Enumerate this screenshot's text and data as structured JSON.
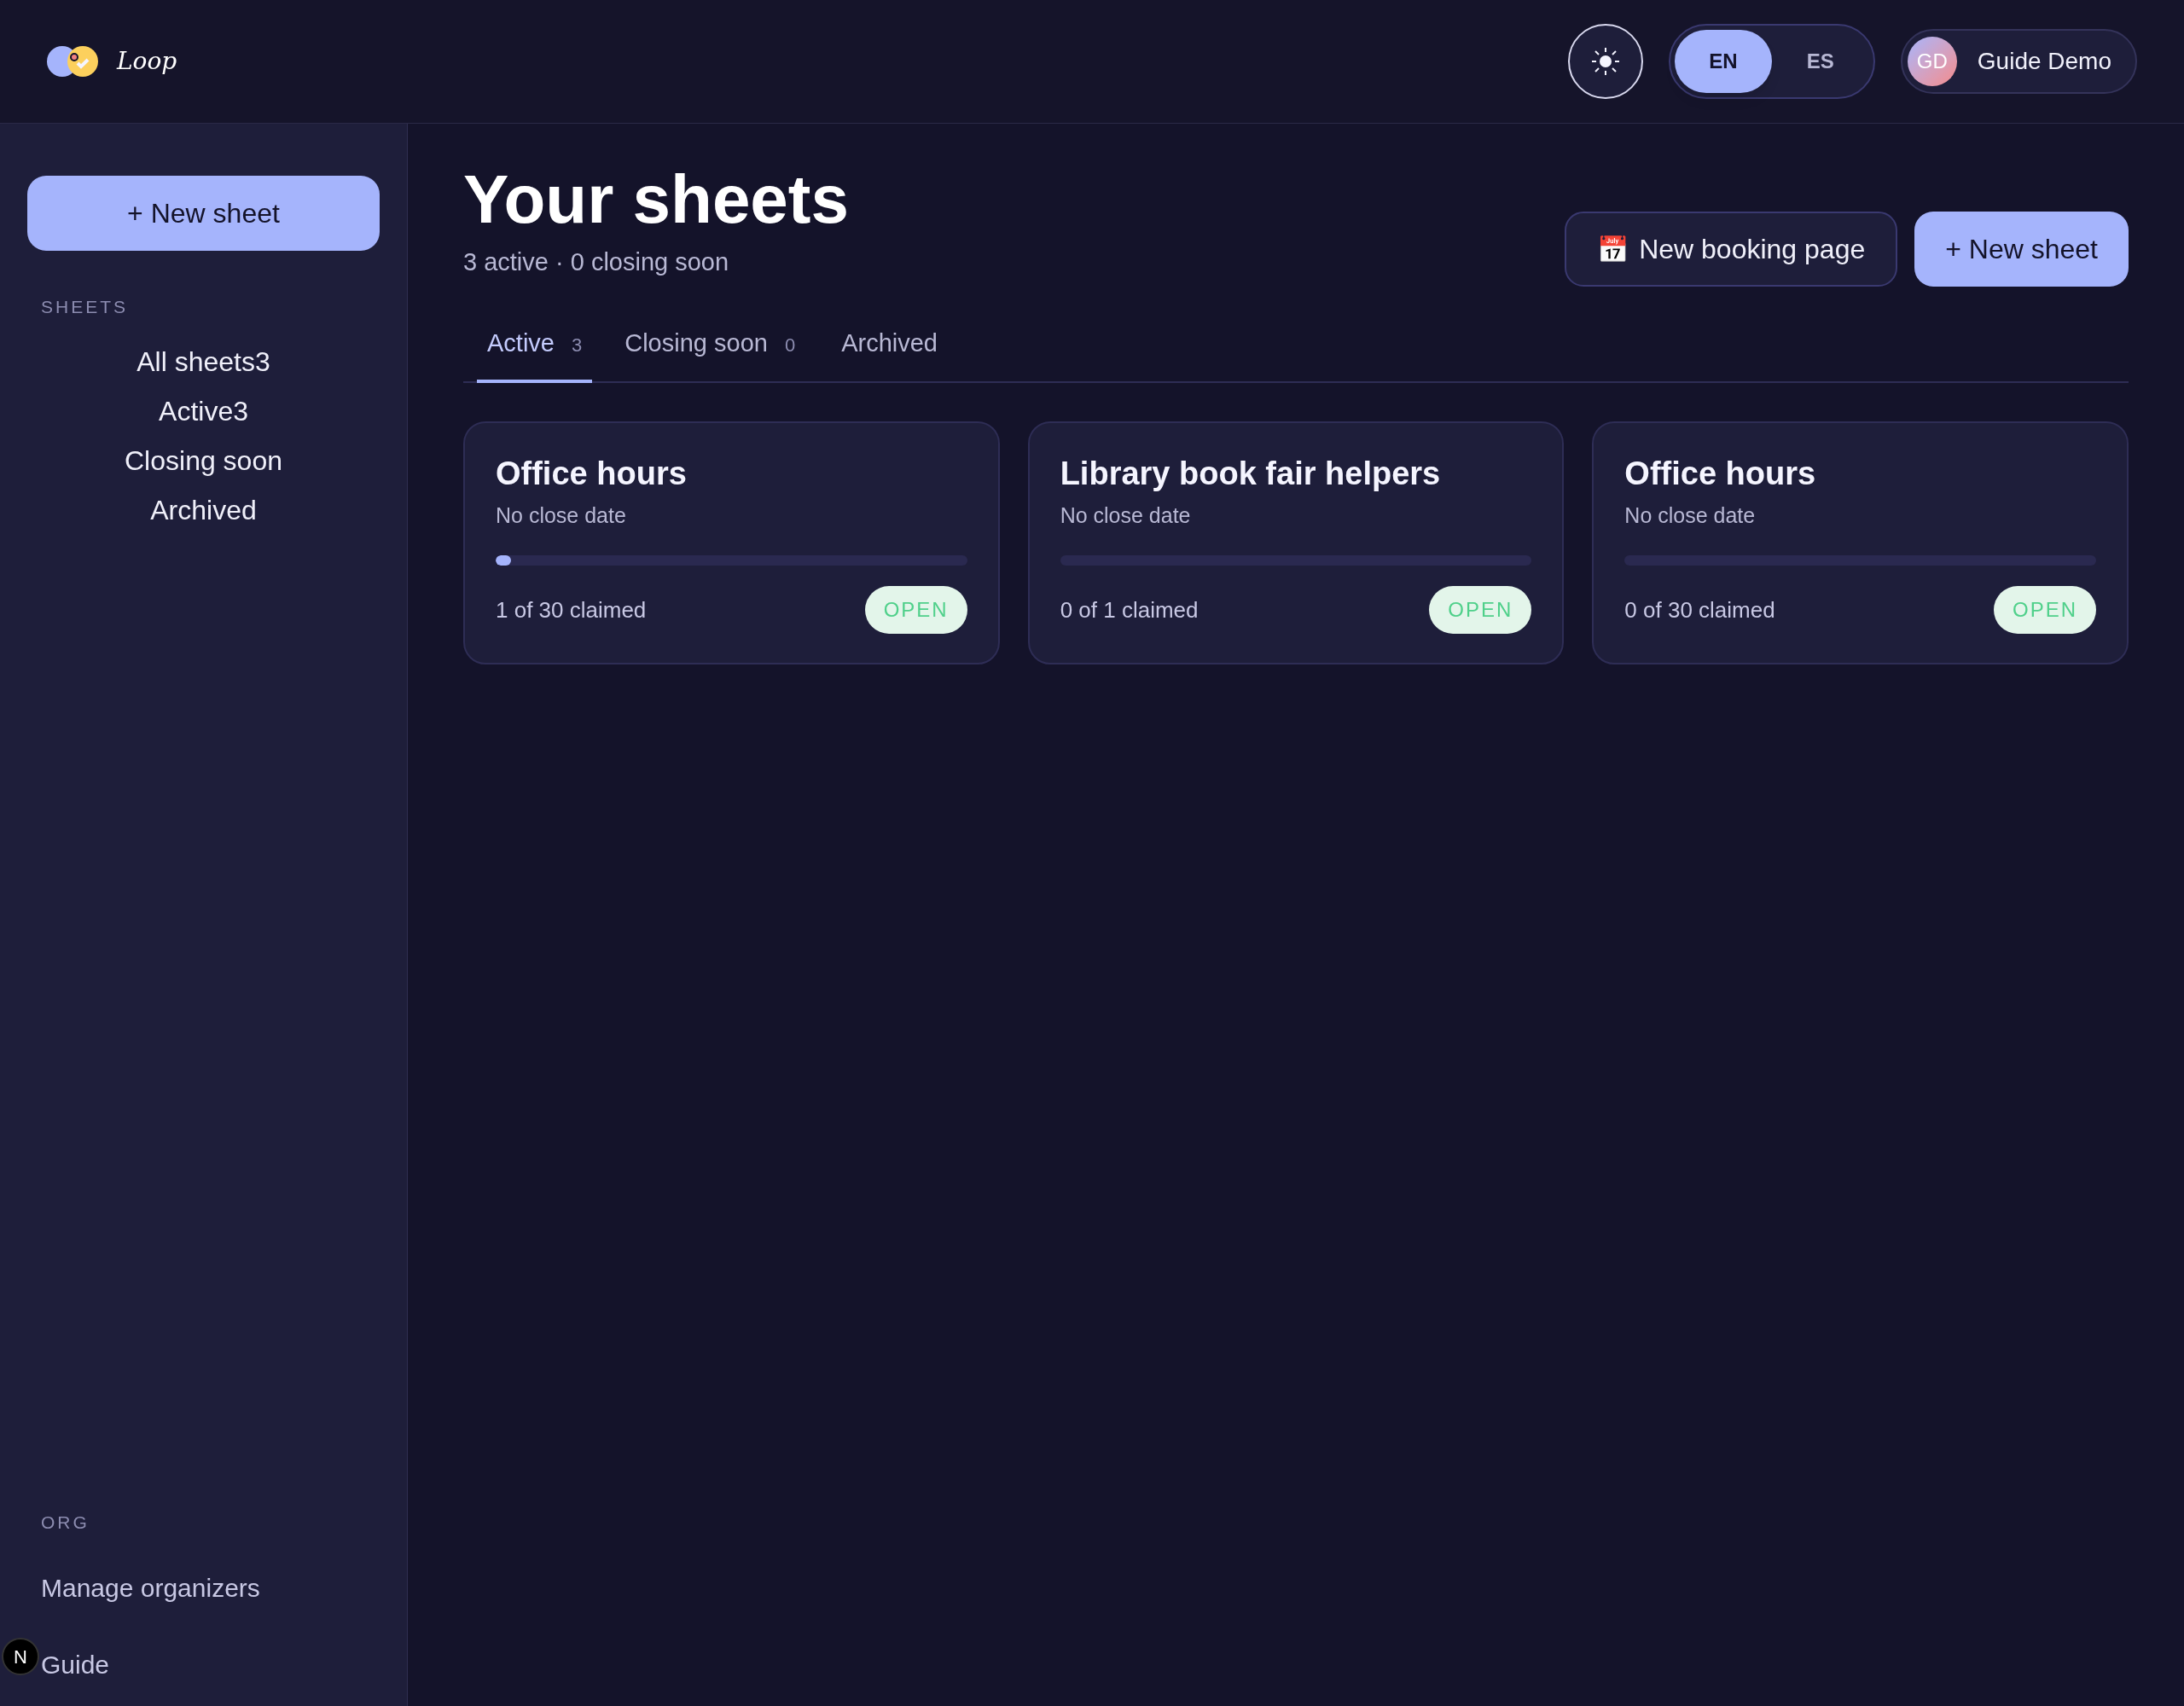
{
  "header": {
    "logo_text": "Loop",
    "languages": [
      {
        "label": "EN",
        "selected": true
      },
      {
        "label": "ES",
        "selected": false
      }
    ],
    "user": {
      "initials": "GD",
      "name": "Guide Demo"
    }
  },
  "sidebar": {
    "new_button": "+ New sheet",
    "sections": [
      {
        "title": "SHEETS",
        "kind": "centered",
        "items": [
          "All sheets3",
          "Active3",
          "Closing soon",
          "Archived"
        ]
      },
      {
        "title": "ORG",
        "kind": "left",
        "items": [
          "Manage organizers",
          "Guide"
        ]
      }
    ]
  },
  "page": {
    "title": "Your sheets",
    "subtitle": "3 active · 0 closing soon",
    "actions": [
      {
        "label": "New booking page",
        "kind": "secondary",
        "icon": "📅"
      },
      {
        "label": "+ New sheet",
        "kind": "primary"
      }
    ]
  },
  "tabs": [
    {
      "label": "Active",
      "count": "3",
      "selected": true
    },
    {
      "label": "Closing soon",
      "count": "0",
      "selected": false
    },
    {
      "label": "Archived",
      "selected": false
    }
  ],
  "cards": [
    {
      "title": "Office hours",
      "close": "No close date",
      "level": 0.033,
      "claimed": "1 of 30 claimed",
      "status": "OPEN"
    },
    {
      "title": "Library book fair helpers",
      "close": "No close date",
      "level": 0,
      "claimed": "0 of 1 claimed",
      "status": "OPEN"
    },
    {
      "title": "Office hours",
      "close": "No close date",
      "level": 0,
      "claimed": "0 of 30 claimed",
      "status": "OPEN"
    }
  ],
  "dev_badge": {
    "letter": "N"
  }
}
